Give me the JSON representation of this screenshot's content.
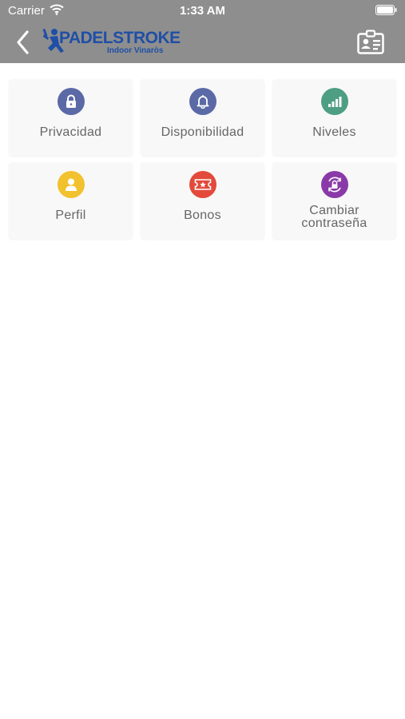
{
  "status_bar": {
    "carrier": "Carrier",
    "time": "1:33 AM"
  },
  "header": {
    "logo_brand": "PADELSTROKE",
    "logo_sub": "Indoor Vinaròs",
    "back_icon": "chevron-left-icon",
    "right_icon": "id-card-icon"
  },
  "menu": {
    "items": [
      {
        "label": "Privacidad",
        "icon": "lock-icon",
        "color": "#5b6aa6"
      },
      {
        "label": "Disponibilidad",
        "icon": "bell-icon",
        "color": "#5b6aa6"
      },
      {
        "label": "Niveles",
        "icon": "signal-bars-icon",
        "color": "#4e9e83"
      },
      {
        "label": "Perfil",
        "icon": "user-icon",
        "color": "#f2c12e"
      },
      {
        "label": "Bonos",
        "icon": "ticket-icon",
        "color": "#e34a3b"
      },
      {
        "label": "Cambiar\ncontraseña",
        "icon": "password-refresh-icon",
        "color": "#8a3aa8"
      }
    ]
  },
  "colors": {
    "header_bg": "#8e8e8e",
    "tile_bg": "#f8f8f8",
    "label": "#666666",
    "logo": "#1f4fa6"
  }
}
